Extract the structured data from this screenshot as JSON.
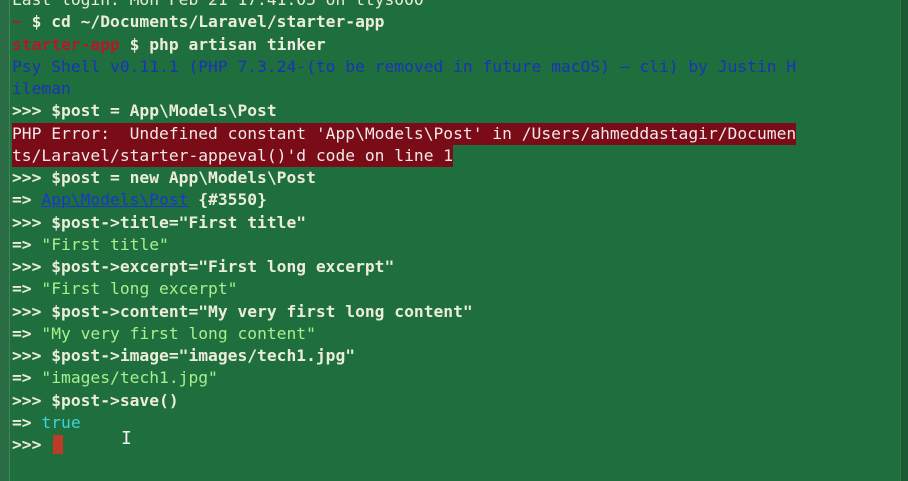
{
  "terminal": {
    "lines": [
      {
        "segments": [
          {
            "text": "Last login: Mon Feb 21 17:41:05 on ttys000",
            "style": "white"
          }
        ]
      },
      {
        "segments": [
          {
            "text": "~ ",
            "style": "red-bold"
          },
          {
            "text": "$ cd ~/Documents/Laravel/starter-app",
            "style": "white bold"
          }
        ]
      },
      {
        "segments": [
          {
            "text": "starter-app",
            "style": "red-bold"
          },
          {
            "text": " $ php artisan tinker",
            "style": "white bold"
          }
        ]
      },
      {
        "segments": [
          {
            "text": "Psy Shell v0.11.1 (PHP 7.3.24-(to be removed in future macOS) — cli) by Justin H",
            "style": "psy"
          }
        ]
      },
      {
        "segments": [
          {
            "text": "ileman",
            "style": "psy"
          }
        ]
      },
      {
        "segments": [
          {
            "text": ">>> $post = App\\Models\\Post",
            "style": "white bold"
          }
        ]
      },
      {
        "segments": [
          {
            "text": "PHP Error:  Undefined constant 'App\\Models\\Post' in /Users/ahmeddastagir/Documen",
            "style": "err"
          }
        ]
      },
      {
        "segments": [
          {
            "text": "ts/Laravel/starter-appeval()'d code on line 1",
            "style": "err"
          }
        ]
      },
      {
        "segments": [
          {
            "text": ">>> $post = new App\\Models\\Post",
            "style": "white bold"
          }
        ]
      },
      {
        "segments": [
          {
            "text": "=> ",
            "style": "white bold"
          },
          {
            "text": "App\\Models\\Post",
            "style": "link"
          },
          {
            "text": " {#3550}",
            "style": "white bold"
          }
        ]
      },
      {
        "segments": [
          {
            "text": ">>> $post->title=\"First title\"",
            "style": "white bold"
          }
        ]
      },
      {
        "segments": [
          {
            "text": "=> ",
            "style": "white bold"
          },
          {
            "text": "\"First title\"",
            "style": "lightgreen"
          }
        ]
      },
      {
        "segments": [
          {
            "text": ">>> $post->excerpt=\"First long excerpt\"",
            "style": "white bold"
          }
        ]
      },
      {
        "segments": [
          {
            "text": "=> ",
            "style": "white bold"
          },
          {
            "text": "\"First long excerpt\"",
            "style": "lightgreen"
          }
        ]
      },
      {
        "segments": [
          {
            "text": ">>> $post->content=\"My very first long content\"",
            "style": "white bold"
          }
        ]
      },
      {
        "segments": [
          {
            "text": "=> ",
            "style": "white bold"
          },
          {
            "text": "\"My very first long content\"",
            "style": "lightgreen"
          }
        ]
      },
      {
        "segments": [
          {
            "text": ">>> $post->image=\"images/tech1.jpg\"",
            "style": "white bold"
          }
        ]
      },
      {
        "segments": [
          {
            "text": "=> ",
            "style": "white bold"
          },
          {
            "text": "\"images/tech1.jpg\"",
            "style": "lightgreen"
          }
        ]
      },
      {
        "segments": [
          {
            "text": ">>> $post->save()",
            "style": "white bold"
          }
        ]
      },
      {
        "segments": [
          {
            "text": "=> ",
            "style": "white bold"
          },
          {
            "text": "true",
            "style": "cyan"
          }
        ]
      },
      {
        "segments": [
          {
            "text": ">>> ",
            "style": "white bold"
          }
        ],
        "cursor": true
      }
    ],
    "colors": {
      "background": "#1f6f3e",
      "prompt_path": "#b4182a",
      "psy_banner": "#1a33b8",
      "error_background": "#7a0c18",
      "string_output": "#a9ee8f",
      "boolean_output": "#3fd3df",
      "cursor": "#c03a28"
    },
    "icons": {
      "cursor": "block-cursor",
      "pointer": "i-beam-pointer-icon"
    }
  }
}
